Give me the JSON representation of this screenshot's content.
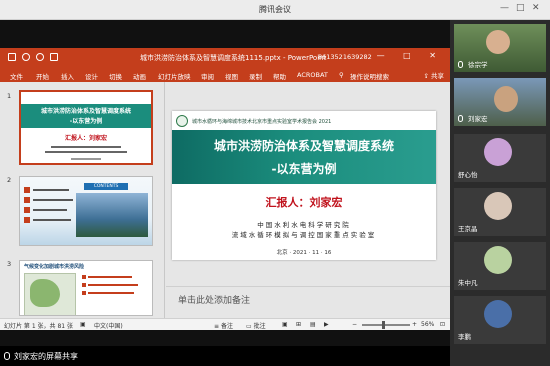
{
  "meeting": {
    "title": "腾讯会议",
    "share_status": "刘家宏的屏幕共享"
  },
  "powerpoint": {
    "file_title": "城市洪涝防治体系及智慧调度系统1115.pptx - PowerPoint",
    "account": "8613521639282",
    "ribbon_tabs": [
      "文件",
      "开始",
      "插入",
      "设计",
      "切换",
      "动画",
      "幻灯片放映",
      "审阅",
      "视图",
      "录制",
      "帮助",
      "ACROBAT",
      "操作说明搜索"
    ],
    "share_label": "共享",
    "notes_placeholder": "单击此处添加备注",
    "status": {
      "slide_count": "幻灯片 第 1 张，共 81 张",
      "language": "中文(中国)",
      "notes": "备注",
      "comments": "批注",
      "zoom": "56%"
    },
    "thumbnails": [
      {
        "num": "1",
        "title": "城市洪涝防治体系及智慧调度系统",
        "subtitle": "-以东营为例",
        "reporter": "汇报人：刘家宏",
        "selected": true
      },
      {
        "num": "2",
        "title": "CONTENTS"
      },
      {
        "num": "3",
        "title": "气候变化加剧城市洪涝风险"
      }
    ]
  },
  "slide": {
    "header": "城市水循环与海绵城市技术北京市重点实验室学术报告会 2021",
    "title_line1": "城市洪涝防治体系及智慧调度系统",
    "title_line2": "-以东营为例",
    "reporter": "汇报人：刘家宏",
    "org_line1": "中国水利水电科学研究院",
    "org_line2": "流域水循环模拟与调控国家重点实验室",
    "date": "北京 · 2021 · 11 · 16"
  },
  "participants": [
    {
      "name": "徐宗学",
      "avatar_color": "#5b7a4a"
    },
    {
      "name": "刘家宏",
      "avatar_color": "#7a6a55"
    },
    {
      "name": "舒心怡",
      "avatar_color": "#c9a1d6"
    },
    {
      "name": "王京晶",
      "avatar_color": "#d9c7b8"
    },
    {
      "name": "朱中凡",
      "avatar_color": "#b9d2a0"
    },
    {
      "name": "李鹏",
      "avatar_color": "#4a6fa8"
    }
  ]
}
